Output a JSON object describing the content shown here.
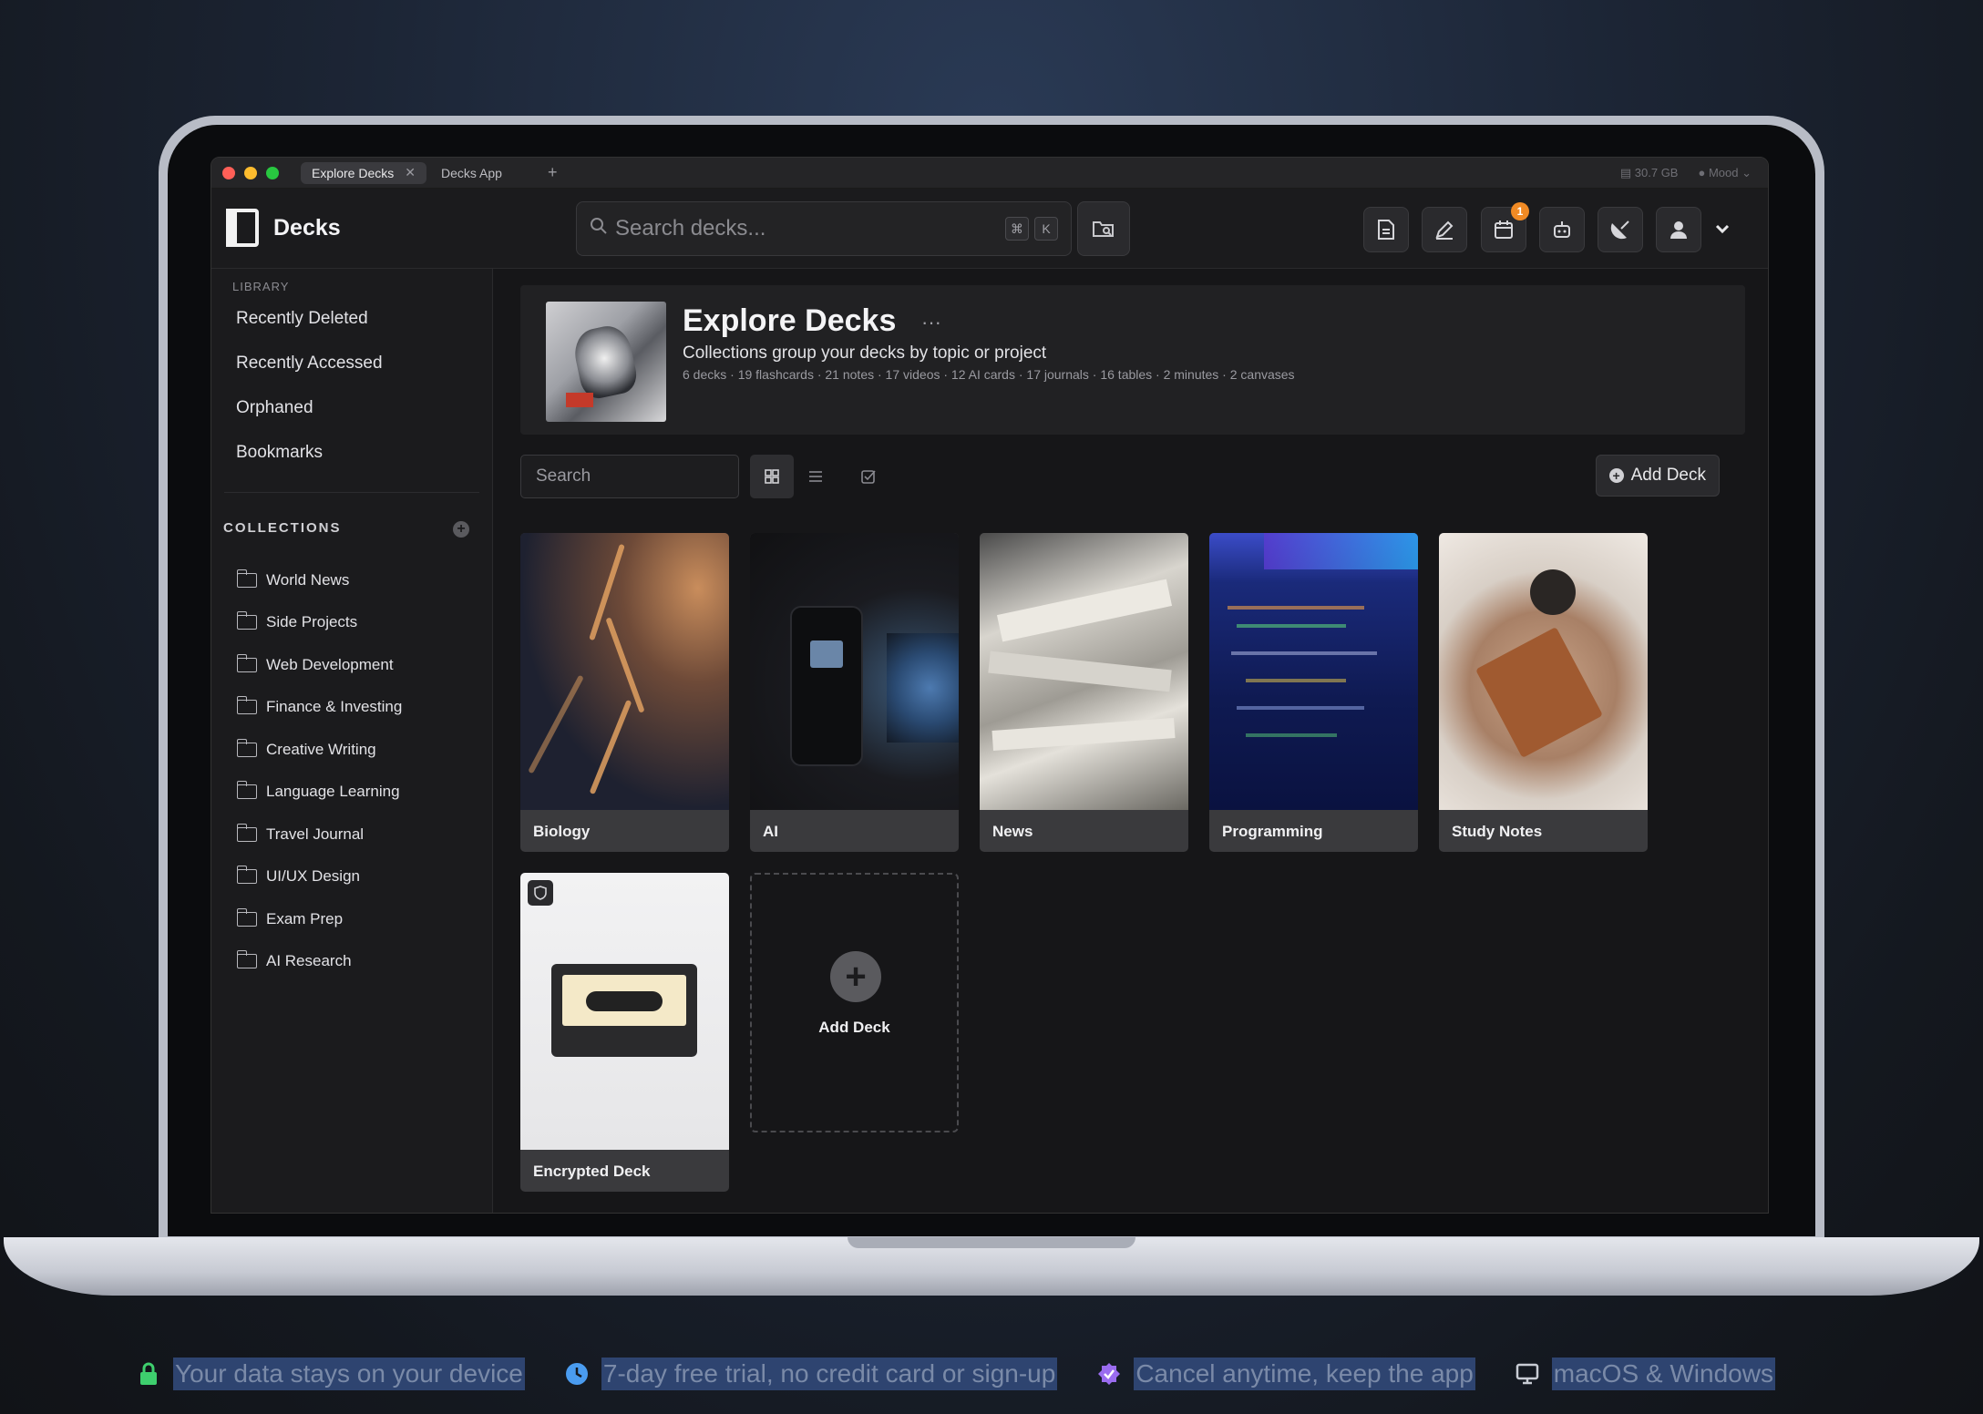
{
  "titlebar": {
    "tabs": [
      {
        "label": "Explore Decks",
        "active": true
      },
      {
        "label": "Decks App",
        "active": false
      }
    ],
    "new_tab": "+",
    "storage": "30.7 GB",
    "mood": "Mood"
  },
  "header": {
    "app_name": "Decks",
    "search_placeholder": "Search decks...",
    "shortcut_keys": [
      "⌘",
      "K"
    ],
    "notification_count": "1"
  },
  "sidebar": {
    "library_label": "LIBRARY",
    "library_items": [
      "Recently Deleted",
      "Recently Accessed",
      "Orphaned",
      "Bookmarks"
    ],
    "collections_label": "COLLECTIONS",
    "collections": [
      "World News",
      "Side Projects",
      "Web Development",
      "Finance & Investing",
      "Creative Writing",
      "Language Learning",
      "Travel Journal",
      "UI/UX Design",
      "Exam Prep",
      "AI Research"
    ]
  },
  "hero": {
    "title": "Explore Decks",
    "more": "···",
    "subtitle": "Collections group your decks by topic or project",
    "stats": "6 decks · 19 flashcards · 21 notes · 17 videos · 12 AI cards · 17 journals · 16 tables · 2 minutes · 2 canvases"
  },
  "toolbar": {
    "search_placeholder": "Search",
    "add_deck_label": "Add Deck"
  },
  "decks": [
    {
      "label": "Biology"
    },
    {
      "label": "AI"
    },
    {
      "label": "News"
    },
    {
      "label": "Programming"
    },
    {
      "label": "Study Notes"
    },
    {
      "label": "Encrypted Deck"
    }
  ],
  "add_card_label": "Add Deck",
  "footer": [
    {
      "text": "Your data stays on your device",
      "icon": "lock-icon",
      "color": "#3ecf6e"
    },
    {
      "text": "7-day free trial, no credit card or sign-up",
      "icon": "clock-icon",
      "color": "#4a9cf0"
    },
    {
      "text": "Cancel anytime, keep the app",
      "icon": "verified-check-icon",
      "color": "#9a6cf0"
    },
    {
      "text": "macOS & Windows",
      "icon": "monitor-icon",
      "color": "#c8ccd4"
    }
  ]
}
